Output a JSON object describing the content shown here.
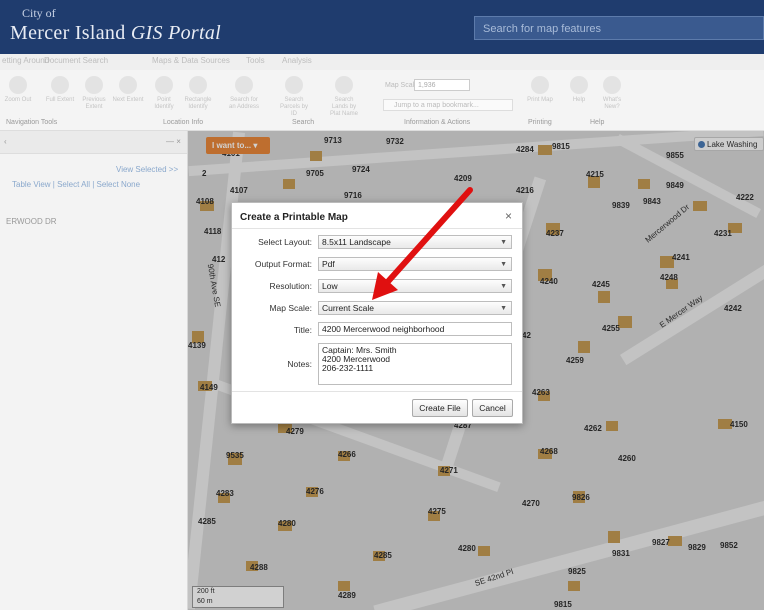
{
  "header": {
    "city": "City of",
    "title_plain": "Mercer Island ",
    "title_italic": "GIS Portal",
    "search_placeholder": "Search for map features"
  },
  "menu": [
    "etting Around",
    "Document Search",
    "Maps & Data Sources",
    "Tools",
    "Analysis"
  ],
  "ribbon": {
    "tools": [
      "Zoom Out",
      "Full Extent",
      "Previous Extent",
      "Next Extent",
      "Point Identify",
      "Rectangle Identify",
      "Search for an Address",
      "Search Parcels by ID",
      "Search Lands by Plat Name",
      "Print Map",
      "Help",
      "What's New?"
    ],
    "groups": [
      "Navigation Tools",
      "Location Info",
      "Search",
      "Information & Actions",
      "Printing",
      "Help"
    ],
    "map_scale_label": "Map Scale: 1:",
    "map_scale_value": "1,936",
    "jump_placeholder": "Jump to a map bookmark..."
  },
  "left_panel": {
    "view_selected": "View Selected >>",
    "links": "Table View  |  Select All  |  Select None",
    "result": "ERWOOD DR"
  },
  "map": {
    "i_want_to": "I want to... ▾",
    "lake_button": "Lake Washing",
    "scale_bar": [
      "200 ft",
      "60 m"
    ],
    "addresses": [
      "4101",
      "9713",
      "9732",
      "4284",
      "9815",
      "9855",
      "2",
      "9705",
      "9724",
      "4209",
      "4216",
      "4215",
      "9849",
      "4107",
      "9716",
      "9839",
      "9843",
      "4222",
      "4108",
      "4118",
      "4237",
      "4231",
      "412",
      "4241",
      "4240",
      "4245",
      "4248",
      "4242",
      "4255",
      "4139",
      "42",
      "4259",
      "4149",
      "4263",
      "4279",
      "4287",
      "4262",
      "4150",
      "9535",
      "4266",
      "4268",
      "4260",
      "4271",
      "4283",
      "4276",
      "9826",
      "4275",
      "4270",
      "4285",
      "4280",
      "4280",
      "9827",
      "9829",
      "9852",
      "9831",
      "4285",
      "4288",
      "9825",
      "4289",
      "9815"
    ],
    "street_labels": [
      "Mercerwood Dr",
      "E Mercer Way",
      "90th Ave SE",
      "SE 42nd Pl"
    ]
  },
  "dialog": {
    "title": "Create a Printable Map",
    "close": "×",
    "fields": {
      "layout": {
        "label": "Select Layout:",
        "value": "8.5x11 Landscape"
      },
      "format": {
        "label": "Output Format:",
        "value": "Pdf"
      },
      "resolution": {
        "label": "Resolution:",
        "value": "Low"
      },
      "scale": {
        "label": "Map Scale:",
        "value": "Current Scale"
      },
      "title": {
        "label": "Title:",
        "value": "4200 Mercerwood neighborhood"
      },
      "notes": {
        "label": "Notes:",
        "lines": [
          "Captain: Mrs. Smith",
          "4200 Mercerwood",
          "206-232-1111"
        ]
      }
    },
    "create_button": "Create File",
    "cancel_button": "Cancel"
  },
  "colors": {
    "header_bg": "#1f3c6e",
    "i_want_bg": "#e8873a",
    "annotation_arrow": "#e01010",
    "lot": "#c49a54"
  }
}
